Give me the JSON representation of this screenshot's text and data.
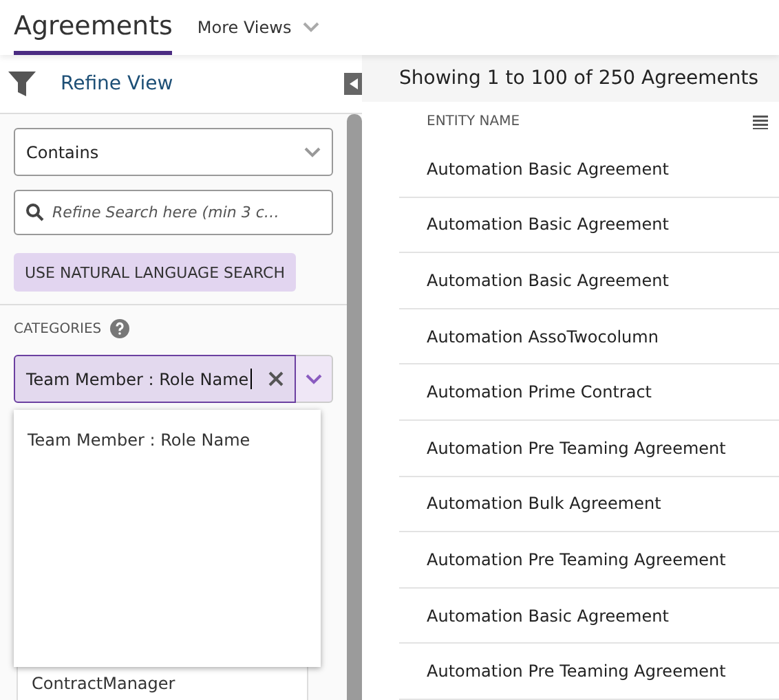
{
  "tabs": [
    {
      "label": "Agreements",
      "selected": true
    },
    {
      "label": "More Views",
      "selected": false
    }
  ],
  "refine": {
    "title": "Refine View",
    "operator": "Contains",
    "search_placeholder": "Refine Search here (min 3 c…",
    "nl_button": "USE NATURAL LANGUAGE SEARCH",
    "categories_label": "CATEGORIES",
    "category_value": "Team Member : Role Name",
    "options": [
      "Team Member : Role Name"
    ],
    "behind_item": "ContractManager"
  },
  "results": {
    "summary": "Showing 1 to 100 of 250 Agreements",
    "column": "ENTITY NAME",
    "rows": [
      "Automation Basic Agreement",
      "Automation Basic Agreement",
      "Automation Basic Agreement",
      "Automation AssoTwocolumn",
      "Automation Prime Contract",
      "Automation Pre Teaming Agreement",
      "Automation Bulk Agreement",
      "Automation Pre Teaming Agreement",
      "Automation Basic Agreement",
      "Automation Pre Teaming Agreement"
    ]
  }
}
